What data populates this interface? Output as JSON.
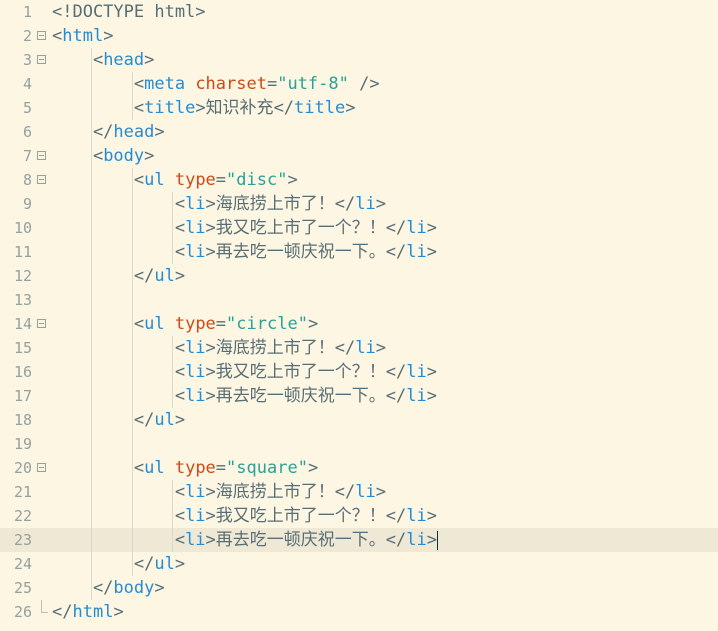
{
  "editor": {
    "active_line": 23,
    "lines": [
      {
        "n": "1",
        "tokens": [
          [
            "p",
            "<!DOCTYPE html>"
          ]
        ]
      },
      {
        "n": "2",
        "tokens": [
          [
            "p",
            "<"
          ],
          [
            "t",
            "html"
          ],
          [
            "p",
            ">"
          ]
        ]
      },
      {
        "n": "3",
        "tokens": [
          [
            "p",
            "    <"
          ],
          [
            "t",
            "head"
          ],
          [
            "p",
            ">"
          ]
        ]
      },
      {
        "n": "4",
        "tokens": [
          [
            "p",
            "        <"
          ],
          [
            "t",
            "meta "
          ],
          [
            "a",
            "charset"
          ],
          [
            "p",
            "="
          ],
          [
            "s",
            "\"utf-8\""
          ],
          [
            "p",
            " />"
          ]
        ]
      },
      {
        "n": "5",
        "tokens": [
          [
            "p",
            "        <"
          ],
          [
            "t",
            "title"
          ],
          [
            "p",
            ">"
          ],
          [
            "x",
            "知识补充"
          ],
          [
            "p",
            "</"
          ],
          [
            "t",
            "title"
          ],
          [
            "p",
            ">"
          ]
        ]
      },
      {
        "n": "6",
        "tokens": [
          [
            "p",
            "    </"
          ],
          [
            "t",
            "head"
          ],
          [
            "p",
            ">"
          ]
        ]
      },
      {
        "n": "7",
        "tokens": [
          [
            "p",
            "    <"
          ],
          [
            "t",
            "body"
          ],
          [
            "p",
            ">"
          ]
        ]
      },
      {
        "n": "8",
        "tokens": [
          [
            "p",
            "        <"
          ],
          [
            "t",
            "ul "
          ],
          [
            "a",
            "type"
          ],
          [
            "p",
            "="
          ],
          [
            "s",
            "\"disc\""
          ],
          [
            "p",
            ">"
          ]
        ]
      },
      {
        "n": "9",
        "tokens": [
          [
            "p",
            "            <"
          ],
          [
            "t",
            "li"
          ],
          [
            "p",
            ">"
          ],
          [
            "x",
            "海底捞上市了！"
          ],
          [
            "p",
            "</"
          ],
          [
            "t",
            "li"
          ],
          [
            "p",
            ">"
          ]
        ]
      },
      {
        "n": "10",
        "tokens": [
          [
            "p",
            "            <"
          ],
          [
            "t",
            "li"
          ],
          [
            "p",
            ">"
          ],
          [
            "x",
            "我又吃上市了一个？！"
          ],
          [
            "p",
            "</"
          ],
          [
            "t",
            "li"
          ],
          [
            "p",
            ">"
          ]
        ]
      },
      {
        "n": "11",
        "tokens": [
          [
            "p",
            "            <"
          ],
          [
            "t",
            "li"
          ],
          [
            "p",
            ">"
          ],
          [
            "x",
            "再去吃一顿庆祝一下。"
          ],
          [
            "p",
            "</"
          ],
          [
            "t",
            "li"
          ],
          [
            "p",
            ">"
          ]
        ]
      },
      {
        "n": "12",
        "tokens": [
          [
            "p",
            "        </"
          ],
          [
            "t",
            "ul"
          ],
          [
            "p",
            ">"
          ]
        ]
      },
      {
        "n": "13",
        "tokens": []
      },
      {
        "n": "14",
        "tokens": [
          [
            "p",
            "        <"
          ],
          [
            "t",
            "ul "
          ],
          [
            "a",
            "type"
          ],
          [
            "p",
            "="
          ],
          [
            "s",
            "\"circle\""
          ],
          [
            "p",
            ">"
          ]
        ]
      },
      {
        "n": "15",
        "tokens": [
          [
            "p",
            "            <"
          ],
          [
            "t",
            "li"
          ],
          [
            "p",
            ">"
          ],
          [
            "x",
            "海底捞上市了！"
          ],
          [
            "p",
            "</"
          ],
          [
            "t",
            "li"
          ],
          [
            "p",
            ">"
          ]
        ]
      },
      {
        "n": "16",
        "tokens": [
          [
            "p",
            "            <"
          ],
          [
            "t",
            "li"
          ],
          [
            "p",
            ">"
          ],
          [
            "x",
            "我又吃上市了一个？！"
          ],
          [
            "p",
            "</"
          ],
          [
            "t",
            "li"
          ],
          [
            "p",
            ">"
          ]
        ]
      },
      {
        "n": "17",
        "tokens": [
          [
            "p",
            "            <"
          ],
          [
            "t",
            "li"
          ],
          [
            "p",
            ">"
          ],
          [
            "x",
            "再去吃一顿庆祝一下。"
          ],
          [
            "p",
            "</"
          ],
          [
            "t",
            "li"
          ],
          [
            "p",
            ">"
          ]
        ]
      },
      {
        "n": "18",
        "tokens": [
          [
            "p",
            "        </"
          ],
          [
            "t",
            "ul"
          ],
          [
            "p",
            ">"
          ]
        ]
      },
      {
        "n": "19",
        "tokens": []
      },
      {
        "n": "20",
        "tokens": [
          [
            "p",
            "        <"
          ],
          [
            "t",
            "ul "
          ],
          [
            "a",
            "type"
          ],
          [
            "p",
            "="
          ],
          [
            "s",
            "\"square\""
          ],
          [
            "p",
            ">"
          ]
        ]
      },
      {
        "n": "21",
        "tokens": [
          [
            "p",
            "            <"
          ],
          [
            "t",
            "li"
          ],
          [
            "p",
            ">"
          ],
          [
            "x",
            "海底捞上市了！"
          ],
          [
            "p",
            "</"
          ],
          [
            "t",
            "li"
          ],
          [
            "p",
            ">"
          ]
        ]
      },
      {
        "n": "22",
        "tokens": [
          [
            "p",
            "            <"
          ],
          [
            "t",
            "li"
          ],
          [
            "p",
            ">"
          ],
          [
            "x",
            "我又吃上市了一个？！"
          ],
          [
            "p",
            "</"
          ],
          [
            "t",
            "li"
          ],
          [
            "p",
            ">"
          ]
        ]
      },
      {
        "n": "23",
        "tokens": [
          [
            "p",
            "            <"
          ],
          [
            "t",
            "li"
          ],
          [
            "p",
            ">"
          ],
          [
            "x",
            "再去吃一顿庆祝一下。"
          ],
          [
            "p",
            "</"
          ],
          [
            "t",
            "li"
          ],
          [
            "p",
            ">"
          ]
        ]
      },
      {
        "n": "24",
        "tokens": [
          [
            "p",
            "        </"
          ],
          [
            "t",
            "ul"
          ],
          [
            "p",
            ">"
          ]
        ]
      },
      {
        "n": "25",
        "tokens": [
          [
            "p",
            "    </"
          ],
          [
            "t",
            "body"
          ],
          [
            "p",
            ">"
          ]
        ]
      },
      {
        "n": "26",
        "tokens": [
          [
            "p",
            "</"
          ],
          [
            "t",
            "html"
          ],
          [
            "p",
            ">"
          ]
        ]
      }
    ],
    "fold_open_lines": [
      "2",
      "3",
      "7",
      "8",
      "14",
      "20"
    ],
    "fold_end_lines": [
      "26"
    ]
  },
  "colors": {
    "background": "#fdf6e3",
    "active_line": "#eee8d5",
    "tag": "#268bd2",
    "attribute": "#cb4b16",
    "string": "#2aa198",
    "text": "#586e75",
    "line_number": "#93a1a1"
  }
}
